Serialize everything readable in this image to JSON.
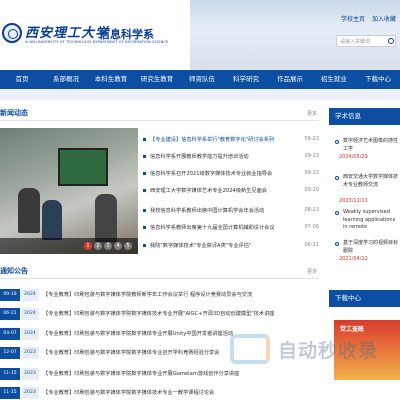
{
  "header": {
    "school_name": "西安理工大学",
    "school_name_en": "XI'AN UNIVERSITY OF TECHNOLOGY DEPARTMENT OF INFORMATION SCIENCE",
    "dept_name": "信息科学系",
    "top_links": [
      "学校主页",
      "加入收藏"
    ],
    "search_placeholder": "请输入关键词"
  },
  "nav": {
    "items": [
      "首页",
      "系部概况",
      "本科生教育",
      "研究生教育",
      "师资队伍",
      "科学研究",
      "作品展示",
      "招生就业",
      "下载中心"
    ]
  },
  "news": {
    "title": "新闻动态",
    "more": "更多",
    "slide_numbers": [
      "1",
      "2",
      "3",
      "4",
      "5"
    ],
    "active_slide": 1,
    "items": [
      {
        "text": "【专业建设】信息科学系举行\"教育数字化\"研讨会系列",
        "date": "09-23"
      },
      {
        "text": "信息科学系开展教师教学能力提升培训活动",
        "date": "09-23"
      },
      {
        "text": "信息科学系召开2021级数字媒体技术专业就业指导会",
        "date": "09-22"
      },
      {
        "text": "西安理工大学数字媒体艺术专业2024级新生见面会",
        "date": "09-20"
      },
      {
        "text": "我校信息科学系教师出席中国计算机学会年会活动",
        "date": "08-23"
      },
      {
        "text": "信息科学系教师出席第十九届全国计算机辅助设计会议",
        "date": "07-06"
      },
      {
        "text": "我院\"数字媒体技术\"专业获评A类\"专业评估\"",
        "date": "06-21"
      }
    ]
  },
  "notices": {
    "title": "通知公告",
    "more": "更多",
    "items": [
      {
        "date": "09-18",
        "year": "2024",
        "text": "【专业教育】印刷包装与数字媒体学院教师新学年工作会议举行 程序设计竞赛动员会与交流"
      },
      {
        "date": "06-21",
        "year": "2024",
        "text": "【专业教育】印刷包装与数字媒体学院数字媒体技术专业开展\"AIGC+开源3D自动创建模型\"技术讲座"
      },
      {
        "date": "04-07",
        "year": "2024",
        "text": "【专业教育】印刷包装与数字媒体学院数字媒体专业开展Unity中国开发者讲座活动"
      },
      {
        "date": "12-07",
        "year": "2023",
        "text": "【专业教育】印刷包装与数字媒体学院数字媒体专业召开学科竞赛经验分享会"
      },
      {
        "date": "11-15",
        "year": "2023",
        "text": "【专业教育】印刷包装与数字媒体学院数字媒体专业开展Gamelam游戏创作分享讲座"
      },
      {
        "date": "11-15",
        "year": "2023",
        "text": "【专业教育】印刷包装与数字媒体学院数字媒体技术专业一教学课程讨论会"
      }
    ]
  },
  "sidebar": {
    "academic_title": "学术信息",
    "academic_items": [
      {
        "text": "数字经济艺术图像的感性工学",
        "date": "2024/05/29"
      },
      {
        "text": "西安交通大学数字媒体技术专业教师交流",
        "date": "2023/12/11"
      },
      {
        "text": "Weakly supervised learning applications in remote",
        "date": ""
      },
      {
        "text": "基于深度学习的视频目标跟踪",
        "date": "2021/04/12"
      }
    ],
    "download_title": "下载中心",
    "download_banner": "党工查账"
  },
  "watermark": {
    "text": "自动秒收录"
  },
  "colors": {
    "brand_blue": "#0b4ea2",
    "accent_red": "#e03a2f"
  }
}
